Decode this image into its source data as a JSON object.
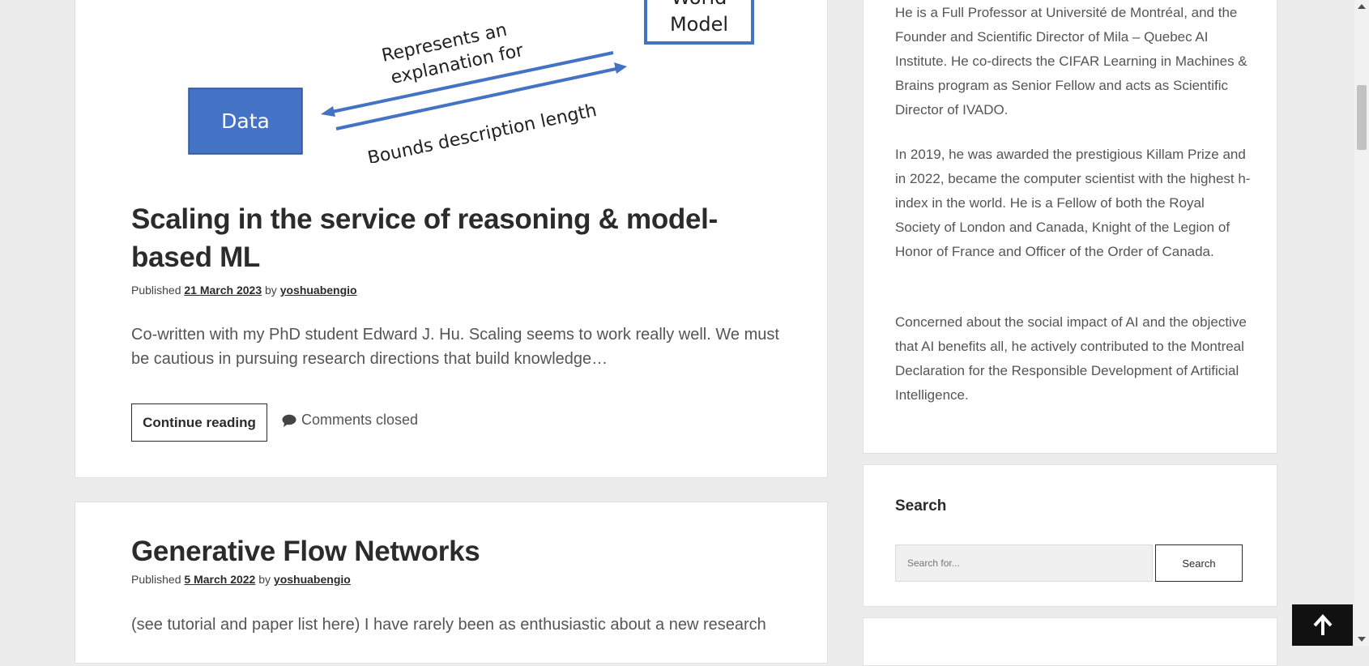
{
  "posts": [
    {
      "diagram": {
        "world_model_line1": "World",
        "world_model_line2": "Model",
        "arrow_label_top_line1": "Represents an",
        "arrow_label_top_line2": "explanation for",
        "data_box_label": "Data",
        "arrow_label_bottom": "Bounds description length",
        "box_color": "#4472c4"
      },
      "title_line1": "Scaling in the service of reasoning & model-",
      "title_line2": "based ML",
      "meta_published": "Published",
      "meta_date": "21 March 2023",
      "meta_by": "by",
      "meta_author": "yoshuabengio",
      "excerpt_line1": "Co-written with my PhD student Edward J. Hu. Scaling seems to work really well. We must",
      "excerpt_line2": "be cautious in pursuing research directions that build knowledge…",
      "continue_label": "Continue reading",
      "comments_label": "Comments closed"
    },
    {
      "title": "Generative Flow Networks",
      "meta_published": "Published",
      "meta_date": "5 March 2022",
      "meta_by": "by",
      "meta_author": "yoshuabengio",
      "excerpt_line1": "(see tutorial and paper list here) I have rarely been as enthusiastic about a new research"
    }
  ],
  "sidebar": {
    "about": {
      "para1": "He is a Full Professor at Université de Montréal, and the Founder and Scientific Director of Mila – Quebec AI Institute. He co-directs the CIFAR Learning in Machines & Brains program as Senior Fellow and acts as Scientific Director of IVADO.",
      "para2": "In 2019, he was awarded the prestigious Killam Prize and in 2022, became the computer scientist with the highest h-index in the world. He is a Fellow of both the Royal Society of London and Canada, Knight of the Legion of Honor of France and Officer of the Order of Canada.",
      "para3": "Concerned about the social impact of AI and the objective that AI benefits all, he actively contributed to the Montreal Declaration for the Responsible Development of Artificial Intelligence."
    },
    "search": {
      "title": "Search",
      "placeholder": "Search for...",
      "button_label": "Search"
    }
  },
  "icons": {
    "comments": "speech-bubble-icon",
    "back_to_top": "arrow-up-icon"
  }
}
